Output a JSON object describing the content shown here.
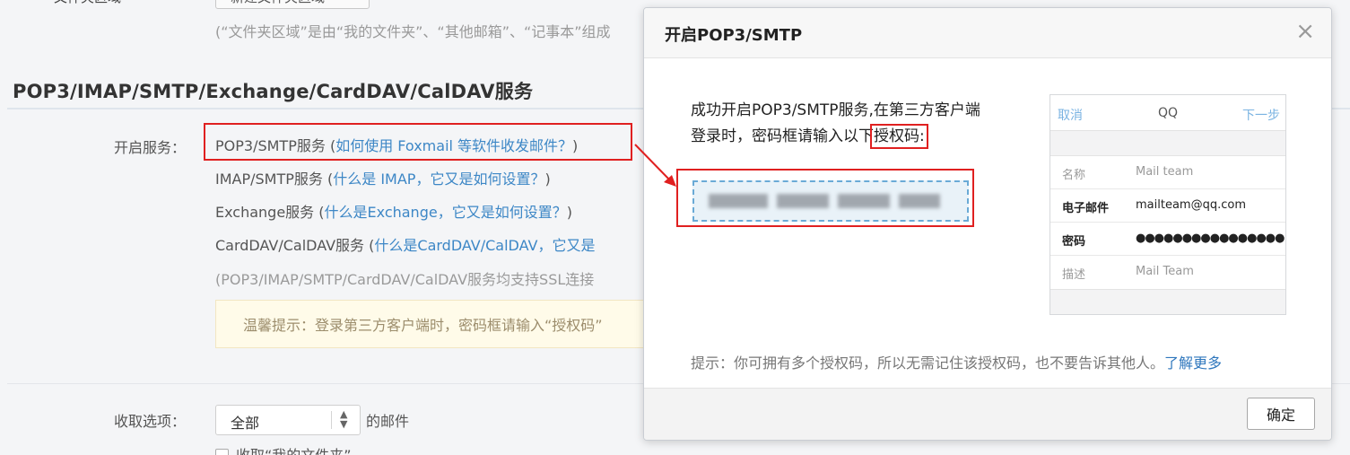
{
  "background": {
    "folder_row_label": "文件夹区域",
    "folder_button": "新建文件夹区域",
    "folder_note": "(“文件夹区域”是由“我的文件夹”、“其他邮箱”、“记事本”组成",
    "section_title": "POP3/IMAP/SMTP/Exchange/CardDAV/CalDAV服务",
    "enable_label": "开启服务：",
    "services": [
      {
        "name": "POP3/SMTP服务",
        "open": " (",
        "link": "如何使用 Foxmail 等软件收发邮件？",
        "close": ")"
      },
      {
        "name": "IMAP/SMTP服务",
        "open": " (",
        "link": "什么是 IMAP，它又是如何设置？",
        "close": ")"
      },
      {
        "name": "Exchange服务",
        "open": " (",
        "link": "什么是Exchange，它又是如何设置？",
        "close": ")"
      },
      {
        "name": "CardDAV/CalDAV服务",
        "open": " (",
        "link": "什么是CardDAV/CalDAV，它又是",
        "close": ""
      }
    ],
    "ssl_note": "(POP3/IMAP/SMTP/CardDAV/CalDAV服务均支持SSL连接",
    "tip": "温馨提示：登录第三方客户端时，密码框请输入“授权码”",
    "fetch_label": "收取选项：",
    "fetch_select": "全部",
    "fetch_after": "的邮件",
    "checkbox_label": "收取“我的文件夹”"
  },
  "dialog": {
    "title": "开启POP3/SMTP",
    "close_glyph": "×",
    "line1": "成功开启POP3/SMTP服务,在第三方客户端",
    "line2_before": "登录时，密码框请输入以下",
    "line2_highlight": "授权码:",
    "phone": {
      "cancel": "取消",
      "title": "QQ",
      "next": "下一步",
      "rows": [
        {
          "key": "名称",
          "value": "Mail team"
        },
        {
          "key": "电子邮件",
          "value": "mailteam@qq.com"
        },
        {
          "key": "密码",
          "value": "●●●●●●●●●●●●●●●●"
        },
        {
          "key": "描述",
          "value": "Mail Team"
        }
      ]
    },
    "tip": "提示：你可拥有多个授权码，所以无需记住该授权码，也不要告诉其他人。",
    "learn_more": "了解更多",
    "ok_button": "确定"
  },
  "colors": {
    "link": "#3d87c6",
    "highlight_red": "#e02020",
    "code_field_bg": "#e9f2f8",
    "code_field_border": "#6aaad6"
  }
}
